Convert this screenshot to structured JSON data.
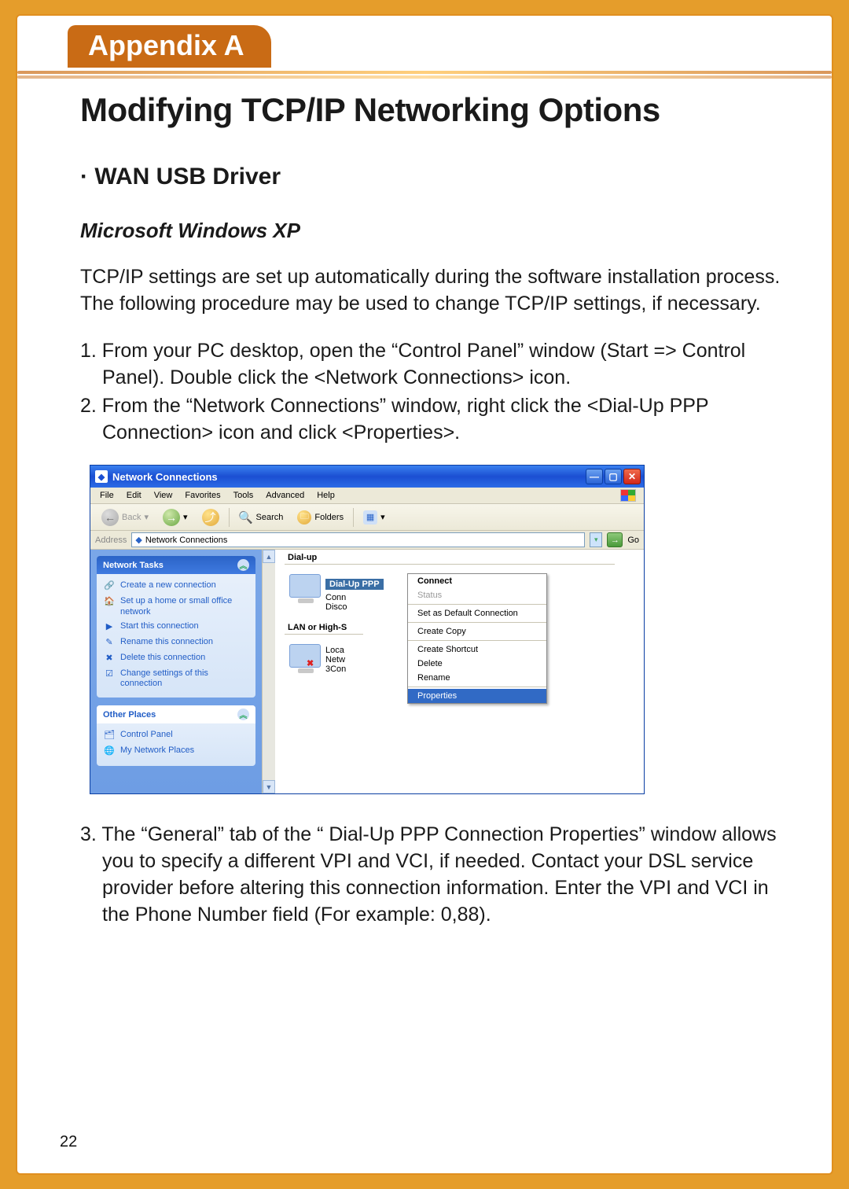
{
  "colors": {
    "accent_orange": "#E59D2B",
    "tab_orange": "#C96B15",
    "xp_blue": "#2b64c7",
    "hl": "#316ac5"
  },
  "appendix_label": "Appendix A",
  "title": "Modifying TCP/IP Networking Options",
  "subhead": "· WAN USB Driver",
  "os_head": "Microsoft Windows XP",
  "intro": "TCP/IP settings are set up automatically during the software installation process. The following procedure may be used to change TCP/IP settings, if necessary.",
  "steps_top": [
    "1. From your PC desktop, open the “Control Panel” window (Start => Control Panel). Double click the <Network Connections> icon.",
    "2. From the “Network Connections” window, right click the  <Dial-Up PPP Connection> icon and click <Properties>."
  ],
  "step_bottom": "3. The “General” tab of the “ Dial-Up PPP Connection Properties” window allows you to specify a different VPI and VCI, if needed. Contact your DSL service provider before altering this connection information. Enter the VPI and VCI in the Phone Number field (For example: 0,88).",
  "page_number": "22",
  "xp": {
    "title": "Network Connections",
    "menu": [
      "File",
      "Edit",
      "View",
      "Favorites",
      "Tools",
      "Advanced",
      "Help"
    ],
    "toolbar": {
      "back": "Back",
      "search": "Search",
      "folders": "Folders"
    },
    "address": {
      "label": "Address",
      "value": "Network Connections",
      "go": "Go"
    },
    "tasks_header": "Network Tasks",
    "tasks": [
      "Create a new connection",
      "Set up a home or small office network",
      "Start this connection",
      "Rename this connection",
      "Delete this connection",
      "Change settings of this connection"
    ],
    "other_header": "Other Places",
    "other": [
      "Control Panel",
      "My Network Places"
    ],
    "group1": "Dial-up",
    "dialup_badge": "Dial-Up PPP",
    "dialup_sub1": "Conn",
    "dialup_sub2": "Disco",
    "group2": "LAN or High-S",
    "lan_sub1": "Loca",
    "lan_sub2": "Netw",
    "lan_sub3": "3Con",
    "ctx": {
      "connect": "Connect",
      "status": "Status",
      "setdefault": "Set as Default Connection",
      "copy": "Create Copy",
      "shortcut": "Create Shortcut",
      "delete": "Delete",
      "rename": "Rename",
      "properties": "Properties"
    }
  }
}
